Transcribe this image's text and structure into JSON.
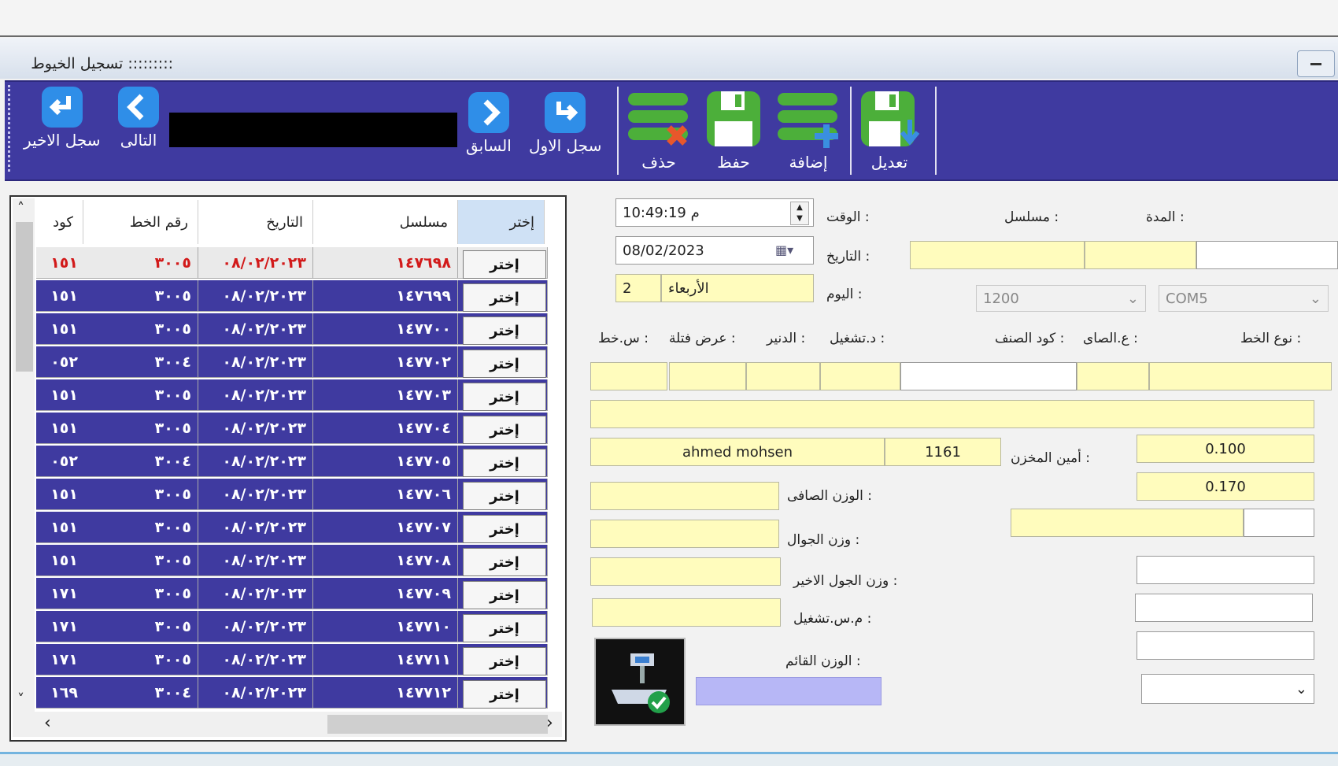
{
  "window": {
    "title": "تسجيل الخيوط :::::::::"
  },
  "toolbar": {
    "edit": "تعديل",
    "add": "إضافة",
    "save": "حفظ",
    "delete": "حذف",
    "first": "سجل الاول",
    "prev": "السابق",
    "next": "التالى",
    "last": "سجل الاخير"
  },
  "grid": {
    "headers": {
      "pick": "إختر",
      "serial": "مسلسل",
      "date": "التاريخ",
      "thread_no": "رقم الخط",
      "code": "كود"
    },
    "pick_label": "إختر",
    "rows": [
      {
        "serial": "١٤٧٦٩٨",
        "date": "٠٨/٠٢/٢٠٢٣",
        "thread": "٣٠٠٥",
        "code": "١٥١"
      },
      {
        "serial": "١٤٧٦٩٩",
        "date": "٠٨/٠٢/٢٠٢٣",
        "thread": "٣٠٠٥",
        "code": "١٥١"
      },
      {
        "serial": "١٤٧٧٠٠",
        "date": "٠٨/٠٢/٢٠٢٣",
        "thread": "٣٠٠٥",
        "code": "١٥١"
      },
      {
        "serial": "١٤٧٧٠٢",
        "date": "٠٨/٠٢/٢٠٢٣",
        "thread": "٣٠٠٤",
        "code": "٠٥٢"
      },
      {
        "serial": "١٤٧٧٠٣",
        "date": "٠٨/٠٢/٢٠٢٣",
        "thread": "٣٠٠٥",
        "code": "١٥١"
      },
      {
        "serial": "١٤٧٧٠٤",
        "date": "٠٨/٠٢/٢٠٢٣",
        "thread": "٣٠٠٥",
        "code": "١٥١"
      },
      {
        "serial": "١٤٧٧٠٥",
        "date": "٠٨/٠٢/٢٠٢٣",
        "thread": "٣٠٠٤",
        "code": "٠٥٢"
      },
      {
        "serial": "١٤٧٧٠٦",
        "date": "٠٨/٠٢/٢٠٢٣",
        "thread": "٣٠٠٥",
        "code": "١٥١"
      },
      {
        "serial": "١٤٧٧٠٧",
        "date": "٠٨/٠٢/٢٠٢٣",
        "thread": "٣٠٠٥",
        "code": "١٥١"
      },
      {
        "serial": "١٤٧٧٠٨",
        "date": "٠٨/٠٢/٢٠٢٣",
        "thread": "٣٠٠٥",
        "code": "١٥١"
      },
      {
        "serial": "١٤٧٧٠٩",
        "date": "٠٨/٠٢/٢٠٢٣",
        "thread": "٣٠٠٥",
        "code": "١٧١"
      },
      {
        "serial": "١٤٧٧١٠",
        "date": "٠٨/٠٢/٢٠٢٣",
        "thread": "٣٠٠٥",
        "code": "١٧١"
      },
      {
        "serial": "١٤٧٧١١",
        "date": "٠٨/٠٢/٢٠٢٣",
        "thread": "٣٠٠٥",
        "code": "١٧١"
      },
      {
        "serial": "١٤٧٧١٢",
        "date": "٠٨/٠٢/٢٠٢٣",
        "thread": "٣٠٠٤",
        "code": "١٦٩"
      }
    ]
  },
  "form": {
    "time_label": "الوقت :",
    "time_value": "م 10:49:19",
    "date_label": "التاريخ :",
    "date_value": "08/02/2023",
    "day_label": "اليوم :",
    "day_num": "2",
    "day_name": "الأربعاء",
    "serial_label": "مسلسل :",
    "duration_label": "المدة :",
    "baud_value": "1200",
    "port_value": "COM5",
    "thread_type_label": "نوع الخط :",
    "net_label": "ع.الصاى :",
    "item_code_label": "كود الصنف :",
    "operation_label": "د.تشغيل :",
    "denier_label": "الدنير :",
    "fiber_width_label": "عرض فتلة :",
    "sth_label": "س.خط :",
    "storekeeper_label": "أمين المخزن :",
    "storekeeper_name": "ahmed mohsen",
    "storekeeper_code": "1161",
    "val1": "0.100",
    "val2": "0.170",
    "net_weight_label": "الوزن الصافى :",
    "sack_weight_label": "وزن الجوال :",
    "last_sack_weight_label": "وزن الجول الاخير :",
    "operation_no_label": "م.س.تشغيل :",
    "standing_weight_label": "الوزن القائم :"
  },
  "colors": {
    "toolbar": "#3f3aa0",
    "field": "#fffcbd",
    "highlight_text": "#d21a1a"
  }
}
